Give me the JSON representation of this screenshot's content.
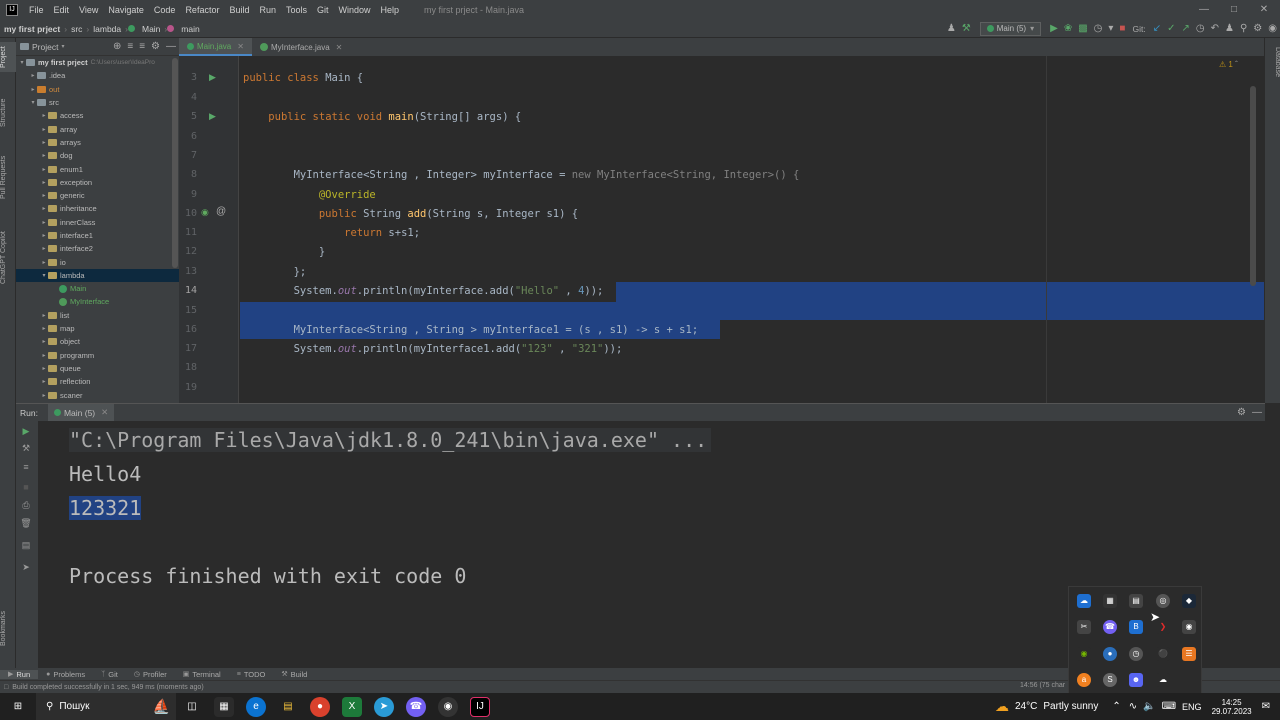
{
  "menubar": {
    "app_logo": "IJ",
    "items": [
      "File",
      "Edit",
      "View",
      "Navigate",
      "Code",
      "Refactor",
      "Build",
      "Run",
      "Tools",
      "Git",
      "Window",
      "Help"
    ],
    "title": "my first prject - Main.java"
  },
  "navbar": {
    "breadcrumbs": [
      "my first prject",
      "src",
      "lambda",
      "Main",
      "main"
    ],
    "run_config": "Main (5)",
    "git_label": "Git:"
  },
  "left_strip": {
    "tabs": [
      "Project",
      "Structure",
      "Pull Requests",
      "ChatGPT Copilot",
      "Bookmarks"
    ]
  },
  "right_strip": {
    "tabs": [
      "Database"
    ]
  },
  "project": {
    "header": "Project",
    "root": "my first prject",
    "root_path": "C:\\Users\\user\\IdeaPro",
    "items": [
      {
        "label": ".idea",
        "depth": 1,
        "kind": "folder-gray",
        "expanded": false
      },
      {
        "label": "out",
        "depth": 1,
        "kind": "folder-orange",
        "expanded": false
      },
      {
        "label": "src",
        "depth": 1,
        "kind": "folder-blue",
        "expanded": true
      },
      {
        "label": "access",
        "depth": 2,
        "kind": "folder",
        "expanded": false
      },
      {
        "label": "array",
        "depth": 2,
        "kind": "folder",
        "expanded": false
      },
      {
        "label": "arrays",
        "depth": 2,
        "kind": "folder",
        "expanded": false
      },
      {
        "label": "dog",
        "depth": 2,
        "kind": "folder",
        "expanded": false
      },
      {
        "label": "enum1",
        "depth": 2,
        "kind": "folder",
        "expanded": false
      },
      {
        "label": "exception",
        "depth": 2,
        "kind": "folder",
        "expanded": false
      },
      {
        "label": "generic",
        "depth": 2,
        "kind": "folder",
        "expanded": false
      },
      {
        "label": "inheritance",
        "depth": 2,
        "kind": "folder",
        "expanded": false
      },
      {
        "label": "innerClass",
        "depth": 2,
        "kind": "folder",
        "expanded": false
      },
      {
        "label": "interface1",
        "depth": 2,
        "kind": "folder",
        "expanded": false
      },
      {
        "label": "interface2",
        "depth": 2,
        "kind": "folder",
        "expanded": false
      },
      {
        "label": "io",
        "depth": 2,
        "kind": "folder",
        "expanded": false
      },
      {
        "label": "lambda",
        "depth": 2,
        "kind": "folder",
        "expanded": true,
        "selected": true
      },
      {
        "label": "Main",
        "depth": 3,
        "kind": "class"
      },
      {
        "label": "MyInterface",
        "depth": 3,
        "kind": "interface"
      },
      {
        "label": "list",
        "depth": 2,
        "kind": "folder",
        "expanded": false
      },
      {
        "label": "map",
        "depth": 2,
        "kind": "folder",
        "expanded": false
      },
      {
        "label": "object",
        "depth": 2,
        "kind": "folder",
        "expanded": false
      },
      {
        "label": "programm",
        "depth": 2,
        "kind": "folder",
        "expanded": false
      },
      {
        "label": "queue",
        "depth": 2,
        "kind": "folder",
        "expanded": false
      },
      {
        "label": "reflection",
        "depth": 2,
        "kind": "folder",
        "expanded": false
      },
      {
        "label": "scaner",
        "depth": 2,
        "kind": "folder",
        "expanded": false
      }
    ]
  },
  "editor": {
    "tabs": [
      {
        "label": "Main.java",
        "active": true
      },
      {
        "label": "MyInterface.java",
        "active": false
      }
    ],
    "warning_count": "1",
    "line_numbers": [
      "3",
      "4",
      "5",
      "6",
      "7",
      "8",
      "9",
      "10",
      "11",
      "12",
      "13",
      "14",
      "15",
      "16",
      "17",
      "18",
      "19"
    ]
  },
  "run": {
    "label": "Run:",
    "tab": "Main (5)",
    "console": {
      "command": "\"C:\\Program Files\\Java\\jdk1.8.0_241\\bin\\java.exe\" ...",
      "out1": "Hello4",
      "out2": "123321",
      "exit": "Process finished with exit code 0"
    }
  },
  "bottom_tabs": [
    "Run",
    "Problems",
    "Git",
    "Profiler",
    "Terminal",
    "TODO",
    "Build"
  ],
  "status": {
    "message": "Build completed successfully in 1 sec, 949 ms (moments ago)",
    "position": "14:56 (75 char"
  },
  "taskbar": {
    "search_placeholder": "Пошук",
    "weather_temp": "24°C",
    "weather_text": "Partly sunny",
    "lang": "ENG",
    "time": "14:25",
    "date": "29.07.2023"
  }
}
